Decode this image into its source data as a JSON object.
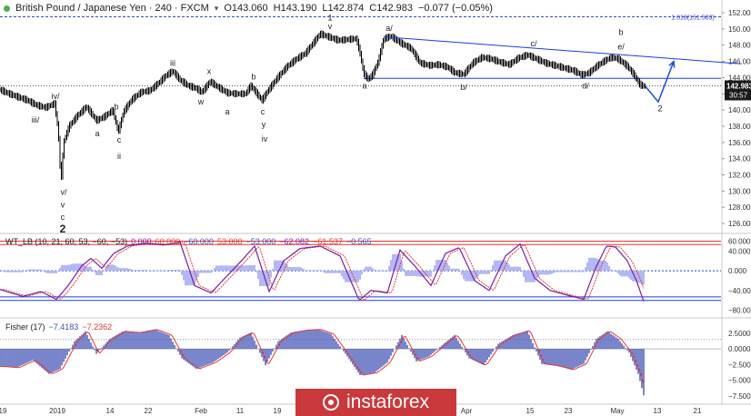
{
  "header": {
    "symbol": "British Pound / Japanese Yen · 240 · FXCM",
    "open": "O143.060",
    "high": "H143.190",
    "low": "L142.874",
    "close": "C142.983",
    "change": "−0.077 (−0.05%)",
    "expand_icon": "chevron-down-icon"
  },
  "colors": {
    "price_bar": "#000000",
    "trend_line": "#1a3ce6",
    "fib_line": "#2c3bd6",
    "wt_line": "#7b1fa2",
    "wt_signal": "#e53935",
    "wt_hist": "#b3b8f5",
    "fisher_fill": "#3f51b5",
    "fisher_line": "#e53935",
    "up_arrow": "#1e4bd8",
    "last_price_bg": "#1a1a1a",
    "watermark_bg": "#c9393c"
  },
  "chart_data": [
    {
      "type": "line",
      "pane": "price",
      "title": "British Pound / Japanese Yen · 240 · FXCM",
      "ylim": [
        125.0,
        152.0
      ],
      "y_ticks": [
        "152.000",
        "150.000",
        "148.000",
        "146.000",
        "144.000",
        "142.000",
        "140.000",
        "138.000",
        "136.000",
        "134.000",
        "132.000",
        "130.000",
        "128.000",
        "126.000"
      ],
      "x_ticks": [
        "19",
        "2019",
        "14",
        "22",
        "Feb",
        "11",
        "19",
        "Apr",
        "15",
        "23",
        "May",
        "13",
        "21"
      ],
      "x_tick_index": [
        0,
        60,
        118,
        160,
        218,
        261,
        302,
        510,
        580,
        622,
        676,
        720,
        764
      ],
      "price_series": [
        [
          0,
          142.5
        ],
        [
          10,
          142.0
        ],
        [
          20,
          141.6
        ],
        [
          30,
          141.2
        ],
        [
          40,
          140.6
        ],
        [
          50,
          140.3
        ],
        [
          60,
          140.8
        ],
        [
          64,
          137.5
        ],
        [
          67,
          131.0
        ],
        [
          70,
          136.0
        ],
        [
          76,
          138.0
        ],
        [
          85,
          139.3
        ],
        [
          95,
          140.4
        ],
        [
          106,
          138.7
        ],
        [
          115,
          139.2
        ],
        [
          124,
          140.0
        ],
        [
          130,
          137.3
        ],
        [
          136,
          139.8
        ],
        [
          145,
          141.3
        ],
        [
          155,
          142.2
        ],
        [
          165,
          142.4
        ],
        [
          175,
          143.4
        ],
        [
          183,
          144.3
        ],
        [
          190,
          144.8
        ],
        [
          198,
          143.7
        ],
        [
          207,
          143.0
        ],
        [
          215,
          142.7
        ],
        [
          222,
          142.2
        ],
        [
          231,
          143.5
        ],
        [
          240,
          142.8
        ],
        [
          250,
          142.1
        ],
        [
          260,
          142.0
        ],
        [
          270,
          142.0
        ],
        [
          276,
          143.0
        ],
        [
          284,
          141.8
        ],
        [
          288,
          141.2
        ],
        [
          296,
          142.6
        ],
        [
          306,
          144.1
        ],
        [
          316,
          145.4
        ],
        [
          326,
          146.3
        ],
        [
          336,
          147.0
        ],
        [
          344,
          148.2
        ],
        [
          352,
          149.4
        ],
        [
          362,
          149.0
        ],
        [
          372,
          148.6
        ],
        [
          382,
          148.7
        ],
        [
          392,
          148.8
        ],
        [
          396,
          147.0
        ],
        [
          400,
          144.5
        ],
        [
          405,
          143.8
        ],
        [
          410,
          144.4
        ],
        [
          416,
          146.0
        ],
        [
          422,
          148.8
        ],
        [
          430,
          149.1
        ],
        [
          440,
          148.3
        ],
        [
          452,
          147.6
        ],
        [
          462,
          145.8
        ],
        [
          472,
          145.5
        ],
        [
          482,
          145.6
        ],
        [
          492,
          145.3
        ],
        [
          500,
          144.6
        ],
        [
          510,
          144.4
        ],
        [
          520,
          145.8
        ],
        [
          530,
          146.5
        ],
        [
          540,
          146.3
        ],
        [
          550,
          145.9
        ],
        [
          560,
          145.6
        ],
        [
          570,
          146.4
        ],
        [
          580,
          146.8
        ],
        [
          590,
          146.3
        ],
        [
          600,
          145.8
        ],
        [
          610,
          145.5
        ],
        [
          620,
          145.2
        ],
        [
          630,
          144.9
        ],
        [
          640,
          144.3
        ],
        [
          648,
          144.6
        ],
        [
          656,
          145.4
        ],
        [
          664,
          146.0
        ],
        [
          672,
          146.5
        ],
        [
          680,
          146.3
        ],
        [
          690,
          145.4
        ],
        [
          698,
          144.2
        ],
        [
          704,
          143.1
        ],
        [
          710,
          142.9
        ]
      ],
      "annotations": [
        {
          "text": "1.618(151.503)",
          "x": 762,
          "y": 151.5
        },
        {
          "text": "1",
          "x": 363,
          "y": 151.4
        },
        {
          "text": "v",
          "x": 363,
          "y": 150.3
        },
        {
          "text": "a/",
          "x": 428,
          "y": 150.1
        },
        {
          "text": "c/",
          "x": 587,
          "y": 148.2
        },
        {
          "text": "b",
          "x": 683,
          "y": 149.6
        },
        {
          "text": "e/",
          "x": 683,
          "y": 147.8
        },
        {
          "text": "iii",
          "x": 190,
          "y": 145.8
        },
        {
          "text": "x",
          "x": 230,
          "y": 144.8
        },
        {
          "text": "b",
          "x": 279,
          "y": 144.1
        },
        {
          "text": "a",
          "x": 401,
          "y": 143.0
        },
        {
          "text": "b/",
          "x": 510,
          "y": 142.8
        },
        {
          "text": "d/",
          "x": 644,
          "y": 143.0
        },
        {
          "text": "iv/",
          "x": 61,
          "y": 141.7
        },
        {
          "text": "i",
          "x": 93,
          "y": 140.0
        },
        {
          "text": "b",
          "x": 128,
          "y": 140.4
        },
        {
          "text": "w",
          "x": 221,
          "y": 141.0
        },
        {
          "text": "a",
          "x": 250,
          "y": 139.8
        },
        {
          "text": "c",
          "x": 289,
          "y": 139.8
        },
        {
          "text": "y",
          "x": 290,
          "y": 138.2
        },
        {
          "text": "iii/",
          "x": 39,
          "y": 138.8
        },
        {
          "text": "a",
          "x": 107,
          "y": 137.1
        },
        {
          "text": "c",
          "x": 131,
          "y": 136.3
        },
        {
          "text": "iv",
          "x": 291,
          "y": 136.4
        },
        {
          "text": "ii",
          "x": 131,
          "y": 134.3
        },
        {
          "text": "2",
          "x": 726,
          "y": 140.2
        },
        {
          "text": "v/",
          "x": 70,
          "y": 129.9
        },
        {
          "text": "v",
          "x": 69,
          "y": 128.3
        },
        {
          "text": "c",
          "x": 69,
          "y": 126.8
        },
        {
          "text": "2",
          "x": 69,
          "y": 125.2
        }
      ],
      "fib_level": 151.503,
      "horizontal_level": 143.9,
      "current_level": 142.983,
      "last_price_label": "142.983",
      "countdown_label": "30:57",
      "trend_line": [
        [
          425,
          149.0
        ],
        [
          815,
          145.7
        ]
      ],
      "projection": [
        [
          710,
          142.9
        ],
        [
          724,
          141.0
        ],
        [
          741,
          146.0
        ]
      ]
    },
    {
      "type": "line",
      "pane": "wt",
      "title": "WT_LB (10, 21, 60, 53, −60, −53)",
      "legend_values": [
        "0.000",
        "60.000",
        "−60.000",
        "53.000",
        "−53.000",
        "−62.082",
        "−61.537",
        "−0.565"
      ],
      "ylim": [
        -90,
        70
      ],
      "y_ticks": [
        "60.000",
        "40.000",
        "0.000",
        "−40.000",
        "−80.000"
      ],
      "levels": [
        60,
        53,
        0,
        -53,
        -60
      ],
      "wt1": [
        [
          0,
          -38
        ],
        [
          25,
          -52
        ],
        [
          45,
          -42
        ],
        [
          62,
          -58
        ],
        [
          75,
          -30
        ],
        [
          90,
          10
        ],
        [
          100,
          25
        ],
        [
          112,
          5
        ],
        [
          125,
          35
        ],
        [
          140,
          50
        ],
        [
          160,
          56
        ],
        [
          180,
          52
        ],
        [
          198,
          58
        ],
        [
          214,
          -30
        ],
        [
          232,
          -45
        ],
        [
          250,
          -10
        ],
        [
          268,
          25
        ],
        [
          280,
          50
        ],
        [
          296,
          -42
        ],
        [
          312,
          20
        ],
        [
          330,
          45
        ],
        [
          352,
          50
        ],
        [
          374,
          30
        ],
        [
          395,
          -60
        ],
        [
          408,
          -40
        ],
        [
          426,
          -45
        ],
        [
          440,
          42
        ],
        [
          456,
          10
        ],
        [
          474,
          -30
        ],
        [
          490,
          35
        ],
        [
          505,
          47
        ],
        [
          522,
          -20
        ],
        [
          538,
          -40
        ],
        [
          556,
          30
        ],
        [
          572,
          54
        ],
        [
          588,
          -15
        ],
        [
          605,
          -40
        ],
        [
          625,
          -50
        ],
        [
          642,
          -58
        ],
        [
          655,
          5
        ],
        [
          667,
          50
        ],
        [
          677,
          48
        ],
        [
          690,
          20
        ],
        [
          700,
          -20
        ],
        [
          708,
          -62
        ]
      ]
    },
    {
      "type": "bar",
      "pane": "fisher",
      "title": "Fisher (17)",
      "legend_values": [
        "−7.4183",
        "−7.2362"
      ],
      "ylim": [
        -8.1,
        4.5
      ],
      "y_ticks": [
        "2.5000",
        "0.0000",
        "−2.5000",
        "−5.0000",
        "−7.5000"
      ],
      "dotted_level": 1.5,
      "fisher": [
        [
          0,
          -2.8
        ],
        [
          18,
          -3.0
        ],
        [
          36,
          -1.8
        ],
        [
          54,
          -4.0
        ],
        [
          66,
          -3.2
        ],
        [
          82,
          1.2
        ],
        [
          94,
          2.8
        ],
        [
          106,
          -0.8
        ],
        [
          120,
          1.5
        ],
        [
          135,
          2.8
        ],
        [
          152,
          2.6
        ],
        [
          170,
          3.1
        ],
        [
          186,
          2.2
        ],
        [
          200,
          -1.5
        ],
        [
          216,
          -3.2
        ],
        [
          234,
          -2.2
        ],
        [
          250,
          -0.6
        ],
        [
          264,
          1.8
        ],
        [
          276,
          2.6
        ],
        [
          292,
          -2.6
        ],
        [
          306,
          1.2
        ],
        [
          320,
          2.6
        ],
        [
          336,
          3.0
        ],
        [
          350,
          3.1
        ],
        [
          364,
          2.4
        ],
        [
          380,
          -0.8
        ],
        [
          396,
          -4.2
        ],
        [
          412,
          -3.8
        ],
        [
          426,
          -2.2
        ],
        [
          442,
          2.2
        ],
        [
          458,
          -2.0
        ],
        [
          472,
          -1.2
        ],
        [
          488,
          0.8
        ],
        [
          500,
          2.2
        ],
        [
          516,
          -1.5
        ],
        [
          532,
          -2.6
        ],
        [
          548,
          0.8
        ],
        [
          564,
          2.2
        ],
        [
          580,
          2.9
        ],
        [
          596,
          -2.4
        ],
        [
          612,
          -2.7
        ],
        [
          628,
          -3.3
        ],
        [
          642,
          -2.4
        ],
        [
          656,
          1.6
        ],
        [
          668,
          2.8
        ],
        [
          680,
          1.6
        ],
        [
          692,
          -0.6
        ],
        [
          702,
          -4.0
        ],
        [
          708,
          -7.4
        ]
      ]
    }
  ],
  "watermark": {
    "text": "instaforex"
  }
}
